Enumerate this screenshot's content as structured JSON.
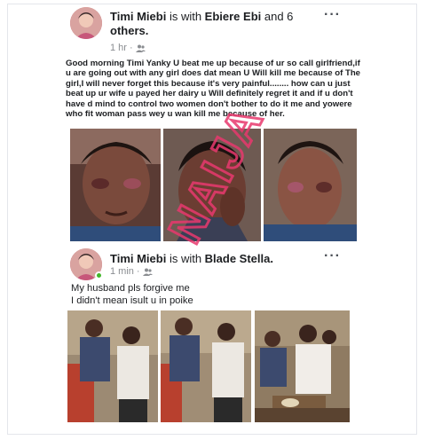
{
  "post1": {
    "author": "Timi Miebi",
    "with_text": " is with ",
    "tagged": "Ebiere Ebi",
    "and_text": " and 6",
    "others": "others.",
    "time": "1 hr",
    "separator": "·",
    "audience_icon": "friends-icon",
    "menu_icon": "more-options-icon",
    "text": "Good morning Timi Yanky U beat me up because of ur so call girlfriend,if u are going out with any girl does dat mean U Will kill me because of The girl,I will never forget this because it's very painful........ how can u just beat up ur wife u payed her dairy u  Will definitely regret it and if u don't have d mind to control two women don't bother to do it me and yowere who fit woman pass wey u wan kill me because of her."
  },
  "post2": {
    "author": "Timi Miebi",
    "with_text": " is with ",
    "tagged": "Blade Stella.",
    "time": "1 min",
    "separator": "·",
    "audience_icon": "friends-icon",
    "menu_icon": "more-options-icon",
    "line1": "My husband pls forgive me",
    "line2": "I didn't mean isult u in poike"
  },
  "colors": {
    "watermark": "#e8396e",
    "link": "#1c1e21",
    "meta": "#8a8d91"
  }
}
